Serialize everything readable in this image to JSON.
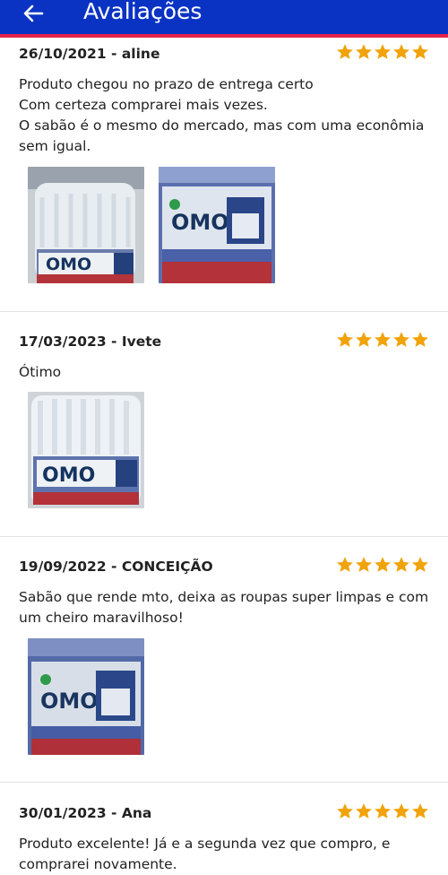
{
  "header": {
    "title": "Avaliações",
    "back_icon": "arrow-left-icon"
  },
  "rating_color": "#f0a30a",
  "reviews": [
    {
      "date_author": "26/10/2021 - aline",
      "stars": 5,
      "text": "Produto chegou no prazo de entrega certo\nCom certeza comprarei mais vezes.\nO sabão é o mesmo do mercado, mas com uma econômia sem igual.",
      "photos": [
        {
          "brand": "OMO",
          "style": "jug-white"
        },
        {
          "brand": "OMO",
          "style": "jug-blue"
        }
      ]
    },
    {
      "date_author": "17/03/2023 - Ivete",
      "stars": 5,
      "text": "Ótimo",
      "photos": [
        {
          "brand": "OMO",
          "style": "jug-white"
        }
      ]
    },
    {
      "date_author": "19/09/2022 - CONCEIÇÃO",
      "stars": 5,
      "text": "Sabão que rende mto, deixa as roupas super limpas e com um cheiro maravilhoso!",
      "photos": [
        {
          "brand": "OMO",
          "style": "jug-blue"
        }
      ]
    },
    {
      "date_author": "30/01/2023 - Ana",
      "stars": 5,
      "text": "Produto excelente! Já e a segunda vez que compro, e comprarei novamente.",
      "photos": []
    }
  ]
}
